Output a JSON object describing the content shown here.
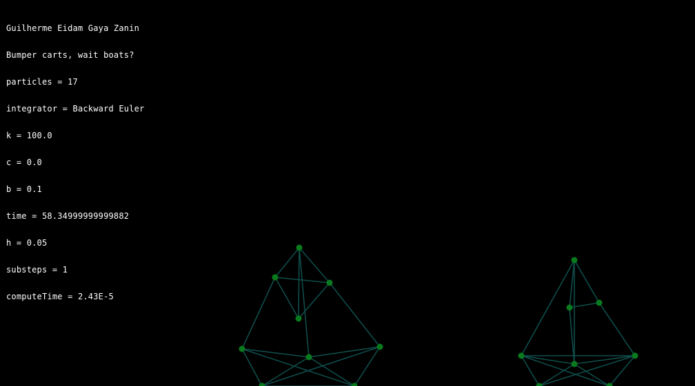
{
  "hud": {
    "author": "Guilherme Eidam Gaya Zanin",
    "subtitle": "Bumper carts, wait boats?",
    "particles": "particles = 17",
    "integrator": "integrator = Backward Euler",
    "k": "k = 100.0",
    "c": "c = 0.0",
    "b": "b = 0.1",
    "time": "time = 58.34999999999882",
    "h": "h = 0.05",
    "substeps": "substeps = 1",
    "computeTime": "computeTime = 2.43E-5"
  },
  "colors": {
    "background": "#000000",
    "text": "#ffffff",
    "particle": "#0a7a1e",
    "spring": "#0f4d4a"
  }
}
